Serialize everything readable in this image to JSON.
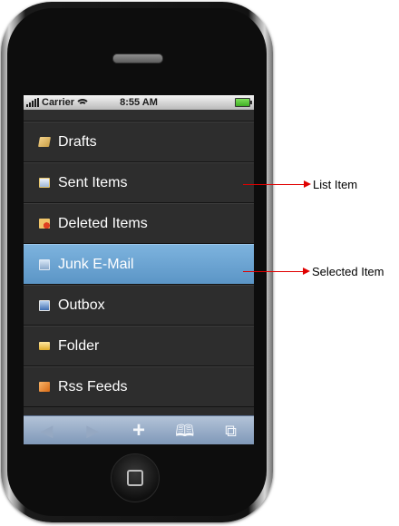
{
  "status_bar": {
    "carrier": "Carrier",
    "time": "8:55 AM"
  },
  "folders": [
    {
      "label": "Drafts",
      "icon": "drafts-icon"
    },
    {
      "label": "Sent Items",
      "icon": "sent-items-icon"
    },
    {
      "label": "Deleted Items",
      "icon": "deleted-items-icon"
    },
    {
      "label": "Junk E-Mail",
      "icon": "junk-mail-icon",
      "selected": true
    },
    {
      "label": "Outbox",
      "icon": "outbox-icon"
    },
    {
      "label": "Folder",
      "icon": "folder-icon"
    },
    {
      "label": "Rss Feeds",
      "icon": "rss-feed-icon"
    }
  ],
  "toolbar": {
    "back": "◀",
    "forward": "▶",
    "add": "+",
    "bookmarks": "🕮",
    "pages": "⧉"
  },
  "annotations": {
    "list_item": "List Item",
    "selected_item": "Selected Item"
  },
  "colors": {
    "selected": "#6aa3d3",
    "arrow": "#e00000",
    "list_bg": "#2d2d2d"
  }
}
